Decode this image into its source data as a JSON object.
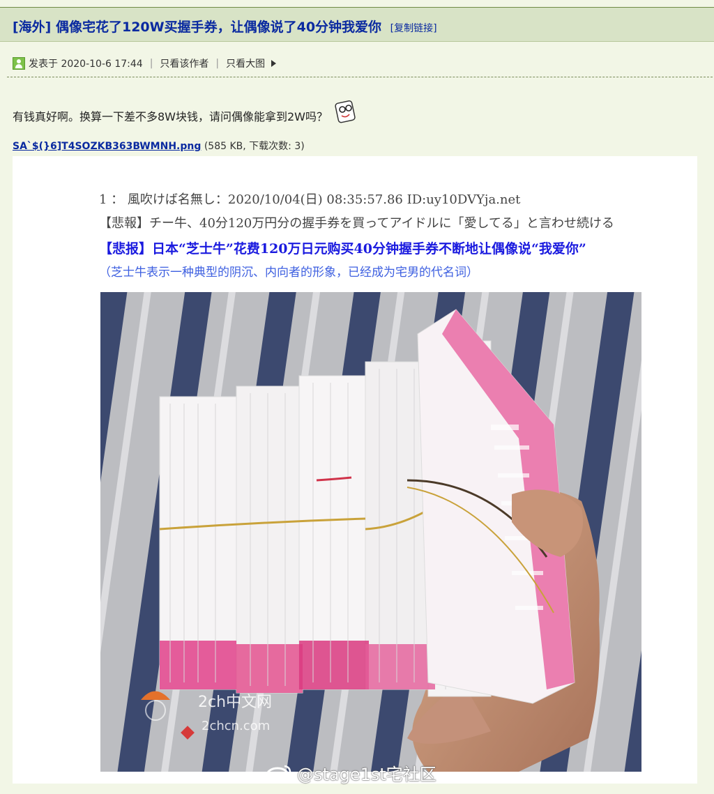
{
  "thread": {
    "title": "[海外] 偶像宅花了120W买握手券，让偶像说了40分钟我爱你",
    "copy_link": "[复制链接]"
  },
  "post": {
    "posted_at": "发表于 2020-10-6 17:44",
    "only_author": "只看该作者",
    "only_big_image": "只看大图",
    "body": "有钱真好啊。换算一下差不多8W块钱，请问偶像能拿到2W吗？",
    "emoticon": "glasses-face-emoticon",
    "attachment": {
      "name": "SA`$(}6]T4SOZKB363BWMNH.png",
      "info": "(585 KB, 下载次数: 3)"
    }
  },
  "image": {
    "line1": "1 ： 風吹けば名無し：2020/10/04(日) 08:35:57.86 ID:uy10DVYja.net",
    "line2": "【悲報】チー牛、40分120万円分の握手券を買ってアイドルに「愛してる」と言わせ続ける",
    "line3": "【悲报】日本“芝士牛”花费120万日元购买40分钟握手券不断地让偶像说“我爱你”",
    "line4": "（芝士牛表示一种典型的阴沉、内向者的形象，已经成为宅男的代名词）",
    "photo_watermark_1": "2ch中文网",
    "photo_watermark_2": "2chcn.com",
    "footer_watermark": "@stage1st宅社区"
  },
  "colors": {
    "page_bg": "#f2f6e6",
    "header_bg": "#d8e3c6",
    "title_blue": "#0a2aa0",
    "highlight_blue": "#1a1adf",
    "ticket_pink": "#e0418a"
  }
}
